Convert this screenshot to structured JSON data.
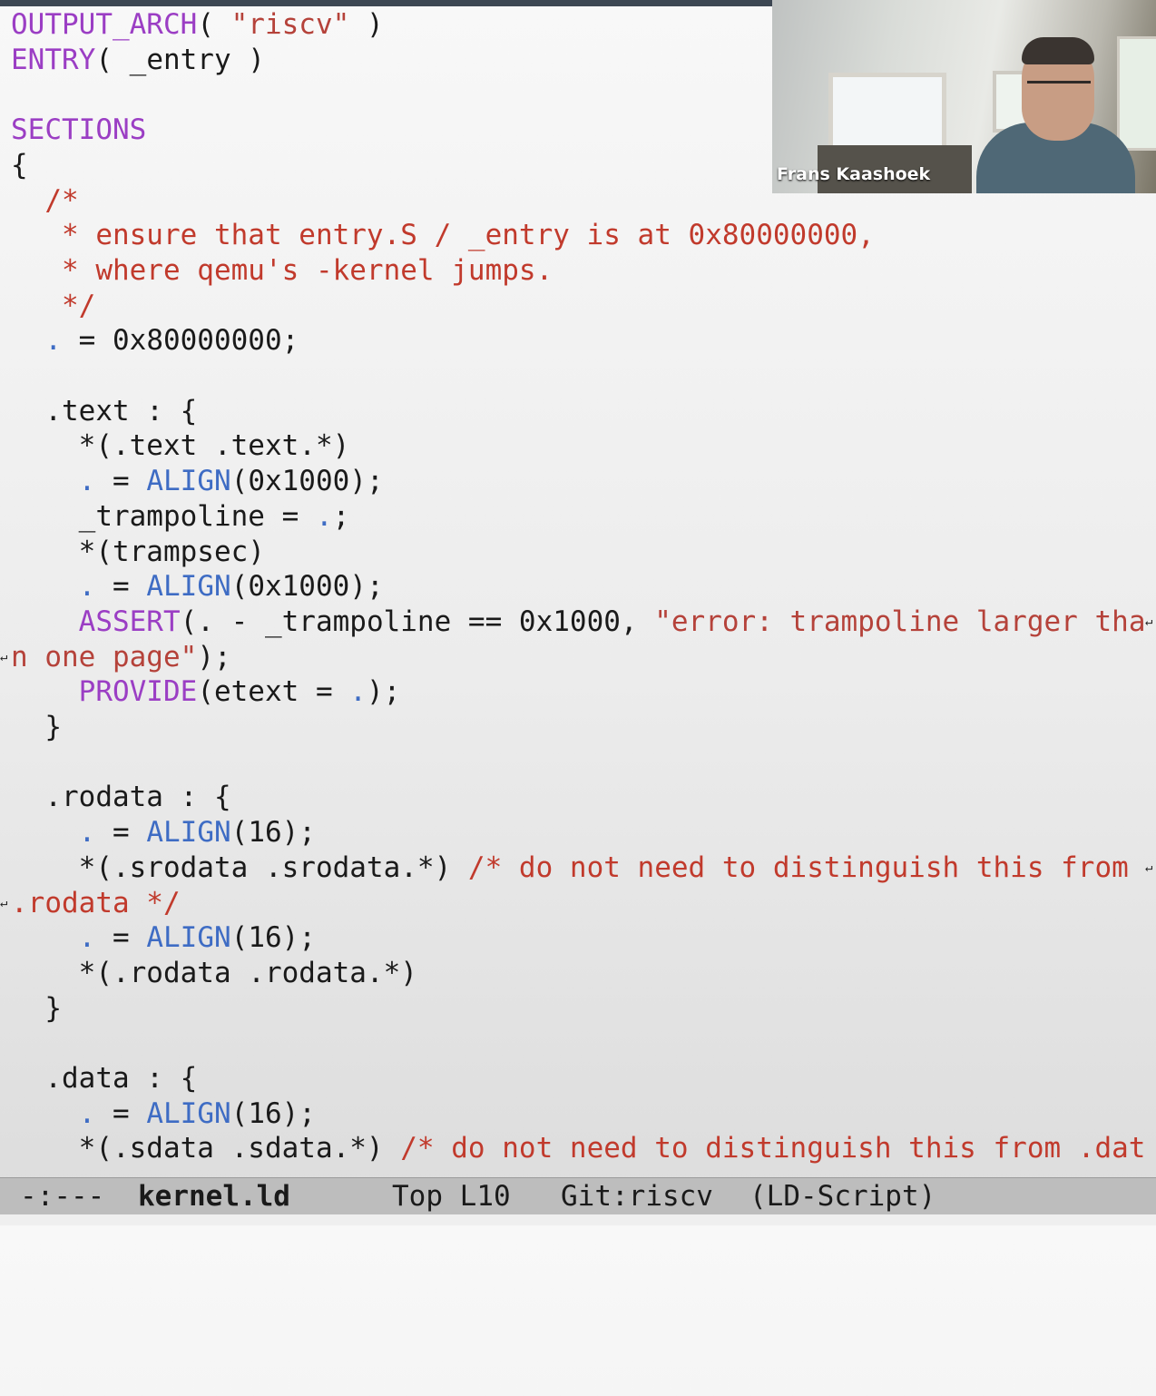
{
  "editor": {
    "lines": [
      [
        {
          "t": "OUTPUT_ARCH",
          "c": "kw"
        },
        {
          "t": "( "
        },
        {
          "t": "\"riscv\"",
          "c": "str"
        },
        {
          "t": " )"
        }
      ],
      [
        {
          "t": "ENTRY",
          "c": "kw"
        },
        {
          "t": "( _entry )"
        }
      ],
      [],
      [
        {
          "t": "SECTIONS",
          "c": "kw"
        }
      ],
      [
        {
          "t": "{"
        }
      ],
      [
        {
          "t": "  /*",
          "c": "cm"
        }
      ],
      [
        {
          "t": "   * ensure that entry.S / _entry is at 0x80000000,",
          "c": "cm"
        }
      ],
      [
        {
          "t": "   * where qemu's -kernel jumps.",
          "c": "cm"
        }
      ],
      [
        {
          "t": "   */",
          "c": "cm"
        }
      ],
      [
        {
          "t": "  "
        },
        {
          "t": ".",
          "c": "op"
        },
        {
          "t": " = 0x80000000;"
        }
      ],
      [],
      [
        {
          "t": "  .text : {"
        }
      ],
      [
        {
          "t": "    *(.text .text.*)"
        }
      ],
      [
        {
          "t": "    "
        },
        {
          "t": ".",
          "c": "op"
        },
        {
          "t": " = "
        },
        {
          "t": "ALIGN",
          "c": "fn"
        },
        {
          "t": "(0x1000);"
        }
      ],
      [
        {
          "t": "    _trampoline = "
        },
        {
          "t": ".",
          "c": "op"
        },
        {
          "t": ";"
        }
      ],
      [
        {
          "t": "    *(trampsec)"
        }
      ],
      [
        {
          "t": "    "
        },
        {
          "t": ".",
          "c": "op"
        },
        {
          "t": " = "
        },
        {
          "t": "ALIGN",
          "c": "fn"
        },
        {
          "t": "(0x1000);"
        }
      ],
      [
        {
          "t": "    "
        },
        {
          "t": "ASSERT",
          "c": "kw"
        },
        {
          "t": "(. - _trampoline == 0x1000, "
        },
        {
          "t": "\"error: trampoline larger tha",
          "c": "str"
        }
      ],
      [
        {
          "t": "n one page\"",
          "c": "str"
        },
        {
          "t": ");"
        }
      ],
      [
        {
          "t": "    "
        },
        {
          "t": "PROVIDE",
          "c": "kw"
        },
        {
          "t": "(etext = "
        },
        {
          "t": ".",
          "c": "op"
        },
        {
          "t": ");"
        }
      ],
      [
        {
          "t": "  }"
        }
      ],
      [],
      [
        {
          "t": "  .rodata : {"
        }
      ],
      [
        {
          "t": "    "
        },
        {
          "t": ".",
          "c": "op"
        },
        {
          "t": " = "
        },
        {
          "t": "ALIGN",
          "c": "fn"
        },
        {
          "t": "(16);"
        }
      ],
      [
        {
          "t": "    *(.srodata .srodata.*) "
        },
        {
          "t": "/* do not need to distinguish this from ",
          "c": "cm"
        }
      ],
      [
        {
          "t": ".rodata */",
          "c": "cm"
        }
      ],
      [
        {
          "t": "    "
        },
        {
          "t": ".",
          "c": "op"
        },
        {
          "t": " = "
        },
        {
          "t": "ALIGN",
          "c": "fn"
        },
        {
          "t": "(16);"
        }
      ],
      [
        {
          "t": "    *(.rodata .rodata.*)"
        }
      ],
      [
        {
          "t": "  }"
        }
      ],
      [],
      [
        {
          "t": "  .data : {"
        }
      ],
      [
        {
          "t": "    "
        },
        {
          "t": ".",
          "c": "op"
        },
        {
          "t": " = "
        },
        {
          "t": "ALIGN",
          "c": "fn"
        },
        {
          "t": "(16);"
        }
      ],
      [
        {
          "t": "    *(.sdata .sdata.*) "
        },
        {
          "t": "/* do not need to distinguish this from .dat",
          "c": "cm"
        }
      ]
    ],
    "continuation_glyph": "↵"
  },
  "modeline": {
    "status": "-:---",
    "buffer_name": "kernel.ld",
    "position": "Top L10",
    "vc": "Git:riscv",
    "mode": "(LD-Script)"
  },
  "video": {
    "participant_name": "Frans Kaashoek"
  }
}
